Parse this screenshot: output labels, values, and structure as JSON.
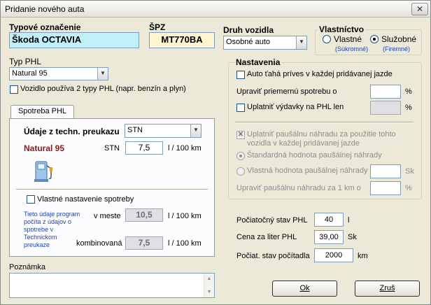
{
  "window": {
    "title": "Pridanie nového auta",
    "close_glyph": "✕"
  },
  "typ_oznacenie": {
    "label": "Typové označenie",
    "value": "Škoda OCTAVIA"
  },
  "spz": {
    "label": "ŠPZ",
    "value": "MT770BA"
  },
  "druh_vozidla": {
    "label": "Druh vozidla",
    "value": "Osobné auto"
  },
  "vlastnictvo": {
    "label": "Vlastníctvo",
    "vlastne": {
      "label": "Vlastné",
      "sub": "(Súkromné)"
    },
    "sluzobne": {
      "label": "Služobné",
      "sub": "(Firemné)"
    },
    "selected": "sluzobne"
  },
  "typ_phl": {
    "label": "Typ PHL",
    "value": "Natural 95"
  },
  "dva_typy": {
    "label": "Vozidlo používa 2 typy PHL (napr. benzín a plyn)",
    "checked": false
  },
  "spotreba": {
    "tab_label": "Spotreba PHL",
    "udaje_label": "Údaje z techn. preukazu",
    "udaje_value": "STN",
    "fuel_name": "Natural 95",
    "stn_label": "STN",
    "stn_value": "7,5",
    "unit": "l / 100 km",
    "vlastne_label": "Vlastné nastavenie spotreby",
    "info_text": "Tieto údaje program počíta z údajov o spotrebe v Technickom preukaze",
    "meste_label": "v meste",
    "meste_value": "10,5",
    "komb_label": "kombinovaná",
    "komb_value": "7,5"
  },
  "nastavenia": {
    "label": "Nastavenia",
    "prives_label": "Auto ťahá príves v každej pridávanej jazde",
    "upravit_spotrebu_label": "Upraviť priemernú spotrebu o",
    "percent": "%",
    "vydavky_label": "Uplatniť výdavky na PHL len",
    "pausal_label_1": "Uplatniť paušálnu náhradu za použitie tohto",
    "pausal_label_2": "vozidla v každej pridávanej jazde",
    "standard_label": "Štandardná hodnota paušálnej náhrady",
    "vlastna_label": "Vlastná hodnota paušálnej náhrady",
    "sk": "Sk",
    "upravit_pausal_label": "Upraviť paušálnu náhradu za 1 km o"
  },
  "pociatocny_stav": {
    "label": "Počiatočný stav PHL",
    "value": "40",
    "unit": "l"
  },
  "cena_liter": {
    "label": "Cena za liter PHL",
    "value": "39,00",
    "unit": "Sk"
  },
  "pociat_pocitadla": {
    "label": "Počiat. stav počítadla",
    "value": "2000",
    "unit": "km"
  },
  "poznamka": {
    "label": "Poznámka",
    "value": ""
  },
  "buttons": {
    "ok": "Ok",
    "zrus": "Zruš"
  },
  "colors": {
    "typ_bg": "#c0f0f8",
    "spz_bg": "#fff5d0",
    "fuel_red": "#8b1a1a",
    "info_blue": "#1c46a8"
  }
}
